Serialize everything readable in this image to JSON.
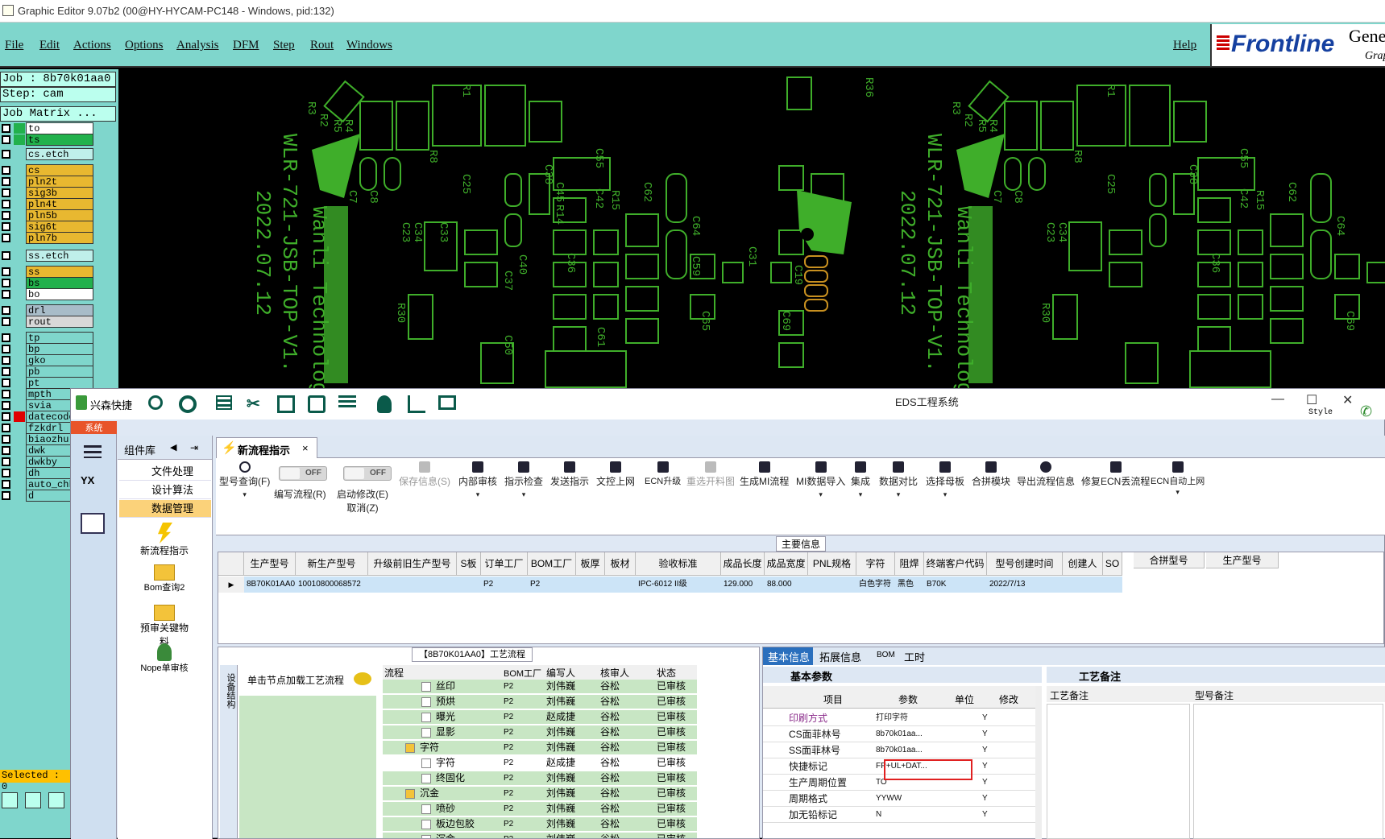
{
  "window": {
    "title": "Graphic Editor 9.07b2 (00@HY-HYCAM-PC148 - Windows, pid:132)"
  },
  "menu": {
    "file": "File",
    "edit": "Edit",
    "actions": "Actions",
    "options": "Options",
    "analysis": "Analysis",
    "dfm": "DFM",
    "step": "Step",
    "rout": "Rout",
    "windows": "Windows",
    "help": "Help"
  },
  "logo": {
    "brand": "Frontline",
    "gene": "Gene",
    "grap": "Grap"
  },
  "job": {
    "job": "Job : 8b70k01aa0",
    "step": "Step: cam",
    "matrix": "Job Matrix ..."
  },
  "layers": [
    {
      "name": "to",
      "color": "#22b14c",
      "bg": "#ffffff"
    },
    {
      "name": "ts",
      "color": "#22b14c",
      "bg": "#22b14c"
    },
    {
      "name": "cs.etch",
      "color": "",
      "bg": "#bfefea"
    },
    {
      "name": "cs",
      "color": "",
      "bg": "#e8b830"
    },
    {
      "name": "pln2t",
      "color": "",
      "bg": "#e8b830"
    },
    {
      "name": "sig3b",
      "color": "",
      "bg": "#e8b830"
    },
    {
      "name": "pln4t",
      "color": "",
      "bg": "#e8b830"
    },
    {
      "name": "pln5b",
      "color": "",
      "bg": "#e8b830"
    },
    {
      "name": "sig6t",
      "color": "",
      "bg": "#e8b830"
    },
    {
      "name": "pln7b",
      "color": "",
      "bg": "#e8b830"
    },
    {
      "name": "ss.etch",
      "color": "",
      "bg": "#bfefea"
    },
    {
      "name": "ss",
      "color": "",
      "bg": "#e8b830"
    },
    {
      "name": "bs",
      "color": "",
      "bg": "#22b14c"
    },
    {
      "name": "bo",
      "color": "",
      "bg": "#ffffff"
    },
    {
      "name": "drl",
      "color": "",
      "bg": "#a8bcc8"
    },
    {
      "name": "rout",
      "color": "",
      "bg": "#d8d8d8"
    },
    {
      "name": "tp",
      "color": "",
      "bg": "#7fd6cc"
    },
    {
      "name": "bp",
      "color": "",
      "bg": "#7fd6cc"
    },
    {
      "name": "gko",
      "color": "",
      "bg": "#7fd6cc"
    },
    {
      "name": "pb",
      "color": "",
      "bg": "#7fd6cc"
    },
    {
      "name": "pt",
      "color": "",
      "bg": "#7fd6cc"
    },
    {
      "name": "mpth",
      "color": "",
      "bg": "#7fd6cc"
    },
    {
      "name": "svia",
      "color": "",
      "bg": "#7fd6cc"
    },
    {
      "name": "datecode",
      "color": "#e00000",
      "bg": "#7fd6cc"
    },
    {
      "name": "fzkdrl",
      "color": "",
      "bg": "#7fd6cc"
    },
    {
      "name": "biaozhu",
      "color": "",
      "bg": "#7fd6cc"
    },
    {
      "name": "dwk",
      "color": "",
      "bg": "#7fd6cc"
    },
    {
      "name": "dwkby",
      "color": "",
      "bg": "#7fd6cc"
    },
    {
      "name": "dh",
      "color": "",
      "bg": "#7fd6cc"
    },
    {
      "name": "auto_chk",
      "color": "",
      "bg": "#7fd6cc"
    },
    {
      "name": "d",
      "color": "",
      "bg": "#7fd6cc"
    }
  ],
  "selected": "Selected : 0",
  "pcb": {
    "text1": "WLR-721-JSB-TOP-V1.",
    "text2": "2022.07.12",
    "text3": "Wanli Technology",
    "r36": "R36",
    "r30": "R30",
    "c31": "C31",
    "c19": "C19",
    "c23": "C23",
    "c34": "C34",
    "c33": "C33",
    "c8": "C8",
    "c7": "C7",
    "r1": "R1",
    "r2": "R2",
    "r3": "R3",
    "r4": "R4",
    "r5": "R5",
    "r8": "R8",
    "c25": "C25",
    "c36": "C36",
    "c38": "C38",
    "c42": "C42",
    "c45": "C45",
    "c55": "C55",
    "c59": "C59",
    "r15": "R15",
    "c62": "C62",
    "r14": "R14",
    "c64": "C64",
    "c37": "C37",
    "c40": "C40",
    "c50": "C50",
    "c61": "C61",
    "c65": "C65",
    "c69": "C69"
  },
  "eds": {
    "app": "兴森快捷",
    "title": "EDS工程系统",
    "style": "Style",
    "sys": "系统",
    "complib": {
      "title": "组件库",
      "items": [
        "文件处理",
        "设计算法",
        "数据管理"
      ],
      "icons": [
        "新流程指示",
        "Bom查询2",
        "预审关键物料",
        "Nope单审核"
      ]
    },
    "tab": "新流程指示",
    "ribbon": [
      "型号查询(F)",
      "编写流程(R)",
      "启动修改(E)",
      "保存信息(S)",
      "内部审核",
      "指示检查",
      "发送指示",
      "文控上网",
      "ECN升级",
      "重选开料图",
      "生成MI流程",
      "MI数据导入",
      "集成",
      "数据对比",
      "选择母板",
      "合拼模块",
      "导出流程信息",
      "修复ECN丢流程",
      "ECN自动上网"
    ],
    "ribbon_sub": "取消(Z)",
    "off": "OFF",
    "main_header": "主要信息",
    "grid": {
      "headers": [
        "生产型号",
        "新生产型号",
        "升级前旧生产型号",
        "S板",
        "订单工厂",
        "BOM工厂",
        "板厚",
        "板材",
        "验收标准",
        "成品长度",
        "成品宽度",
        "PNL规格",
        "字符",
        "阻焊",
        "终端客户代码",
        "型号创建时间",
        "创建人",
        "SO",
        "合拼型号",
        "生产型号"
      ],
      "row": [
        "8B70K01AA0",
        "10010800068572",
        "",
        "",
        "P2",
        "P2",
        "",
        "",
        "IPC-6012 II级",
        "129.000",
        "88.000",
        "",
        "白色字符",
        "黑色",
        "B70K",
        "2022/7/13",
        "",
        ""
      ]
    },
    "flow_header": "【8B70K01AA0】工艺流程",
    "side_tab": "设备结构",
    "load_btn": "单击节点加载工艺流程",
    "flow_cols": [
      "流程",
      "BOM工厂",
      "编写人",
      "核审人",
      "状态"
    ],
    "flow": [
      {
        "name": "丝印",
        "bom": "P2",
        "w": "刘伟巍",
        "a": "谷松",
        "s": "已审核"
      },
      {
        "name": "预烘",
        "bom": "P2",
        "w": "刘伟巍",
        "a": "谷松",
        "s": "已审核"
      },
      {
        "name": "曝光",
        "bom": "P2",
        "w": "赵成捷",
        "a": "谷松",
        "s": "已审核"
      },
      {
        "name": "显影",
        "bom": "P2",
        "w": "刘伟巍",
        "a": "谷松",
        "s": "已审核"
      },
      {
        "name": "字符",
        "bom": "P2",
        "w": "刘伟巍",
        "a": "谷松",
        "s": "已审核"
      },
      {
        "name": "字符",
        "bom": "P2",
        "w": "赵成捷",
        "a": "谷松",
        "s": "已审核"
      },
      {
        "name": "终固化",
        "bom": "P2",
        "w": "刘伟巍",
        "a": "谷松",
        "s": "已审核"
      },
      {
        "name": "沉金",
        "bom": "P2",
        "w": "刘伟巍",
        "a": "谷松",
        "s": "已审核"
      },
      {
        "name": "喷砂",
        "bom": "P2",
        "w": "刘伟巍",
        "a": "谷松",
        "s": "已审核"
      },
      {
        "name": "板边包胶",
        "bom": "P2",
        "w": "刘伟巍",
        "a": "谷松",
        "s": "已审核"
      },
      {
        "name": "沉金",
        "bom": "P2",
        "w": "刘伟巍",
        "a": "谷松",
        "s": "已审核"
      }
    ],
    "info_tabs": [
      "基本信息",
      "拓展信息",
      "BOM",
      "工时"
    ],
    "basic_params": "基本参数",
    "param_cols": [
      "项目",
      "参数",
      "单位",
      "修改"
    ],
    "params": [
      {
        "k": "印刷方式",
        "v": "打印字符",
        "u": "",
        "m": "Y"
      },
      {
        "k": "CS面菲林号",
        "v": "8b70k01aa...",
        "u": "",
        "m": "Y"
      },
      {
        "k": "SS面菲林号",
        "v": "8b70k01aa...",
        "u": "",
        "m": "Y"
      },
      {
        "k": "快捷标记",
        "v": "FP+UL+DAT...",
        "u": "",
        "m": "Y"
      },
      {
        "k": "生产周期位置",
        "v": "TO",
        "u": "",
        "m": "Y"
      },
      {
        "k": "周期格式",
        "v": "YYWW",
        "u": "",
        "m": "Y"
      },
      {
        "k": "加无铅标记",
        "v": "N",
        "u": "",
        "m": "Y"
      }
    ],
    "process_notes": "工艺备注",
    "notes_cols": [
      "工艺备注",
      "型号备注"
    ]
  }
}
